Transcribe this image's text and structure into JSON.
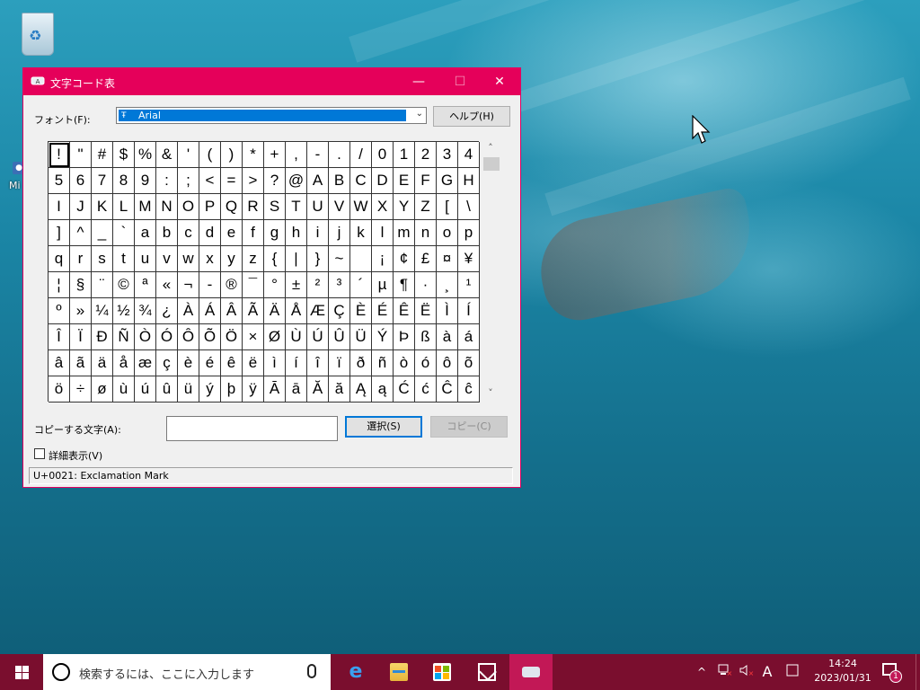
{
  "desktop": {
    "left_icon_label": "Mi"
  },
  "window": {
    "title": "文字コード表",
    "minimize": "—",
    "maximize": "☐",
    "close": "✕",
    "font_label": "フォント(F):",
    "font_value": "Arial",
    "font_type_icon": "truetype-icon",
    "help_button": "ヘルプ(H)",
    "characters": [
      "!",
      "\"",
      "#",
      "$",
      "%",
      "&",
      "'",
      "(",
      ")",
      "*",
      "+",
      ",",
      "-",
      ".",
      "/",
      "0",
      "1",
      "2",
      "3",
      "4",
      "5",
      "6",
      "7",
      "8",
      "9",
      ":",
      ";",
      "<",
      "=",
      ">",
      "?",
      "@",
      "A",
      "B",
      "C",
      "D",
      "E",
      "F",
      "G",
      "H",
      "I",
      "J",
      "K",
      "L",
      "M",
      "N",
      "O",
      "P",
      "Q",
      "R",
      "S",
      "T",
      "U",
      "V",
      "W",
      "X",
      "Y",
      "Z",
      "[",
      "\\",
      "]",
      "^",
      "_",
      "`",
      "a",
      "b",
      "c",
      "d",
      "e",
      "f",
      "g",
      "h",
      "i",
      "j",
      "k",
      "l",
      "m",
      "n",
      "o",
      "p",
      "q",
      "r",
      "s",
      "t",
      "u",
      "v",
      "w",
      "x",
      "y",
      "z",
      "{",
      "|",
      "}",
      "~",
      "",
      "¡",
      "¢",
      "£",
      "¤",
      "¥",
      "¦",
      "§",
      "¨",
      "©",
      "ª",
      "«",
      "¬",
      "-",
      "®",
      "¯",
      "°",
      "±",
      "²",
      "³",
      "´",
      "µ",
      "¶",
      "·",
      "¸",
      "¹",
      "º",
      "»",
      "¼",
      "½",
      "¾",
      "¿",
      "À",
      "Á",
      "Â",
      "Ã",
      "Ä",
      "Å",
      "Æ",
      "Ç",
      "È",
      "É",
      "Ê",
      "Ë",
      "Ì",
      "Í",
      "Î",
      "Ï",
      "Ð",
      "Ñ",
      "Ò",
      "Ó",
      "Ô",
      "Õ",
      "Ö",
      "×",
      "Ø",
      "Ù",
      "Ú",
      "Û",
      "Ü",
      "Ý",
      "Þ",
      "ß",
      "à",
      "á",
      "â",
      "ã",
      "ä",
      "å",
      "æ",
      "ç",
      "è",
      "é",
      "ê",
      "ë",
      "ì",
      "í",
      "î",
      "ï",
      "ð",
      "ñ",
      "ò",
      "ó",
      "ô",
      "õ",
      "ö",
      "÷",
      "ø",
      "ù",
      "ú",
      "û",
      "ü",
      "ý",
      "þ",
      "ÿ",
      "Ā",
      "ā",
      "Ă",
      "ă",
      "Ą",
      "ą",
      "Ć",
      "ć",
      "Ĉ",
      "ĉ"
    ],
    "selected_index": 0,
    "scroll_up": "˄",
    "scroll_down": "˅",
    "copy_label": "コピーする文字(A):",
    "copy_value": "",
    "select_button": "選択(S)",
    "copy_button": "コピー(C)",
    "detail_label": "詳細表示(V)",
    "detail_checked": false,
    "status": "U+0021: Exclamation Mark"
  },
  "taskbar": {
    "search_placeholder": "検索するには、ここに入力します",
    "tray_chevron": "^",
    "ime": "A",
    "time": "14:24",
    "date": "2023/01/31",
    "notification_count": "1",
    "colors": {
      "taskbar": "#7a0e2e",
      "active": "#c21856",
      "titlebar": "#e5005a"
    }
  }
}
